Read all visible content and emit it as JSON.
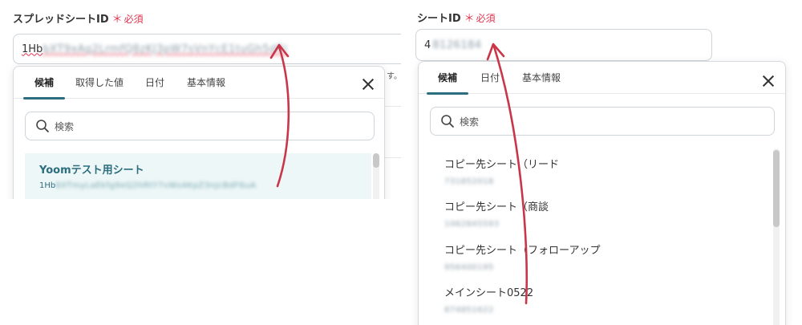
{
  "left": {
    "field": {
      "label": "スプレッドシートID",
      "required_star": "＊",
      "required_text": "必須",
      "value_visible": "1Hb",
      "value_blurred": "bXT9xAq2LrmfQ8zKJ3pW7sVnYcE1tuGh5dRi"
    },
    "hint_suffix": "す。",
    "tabs": [
      "候補",
      "取得した値",
      "日付",
      "基本情報"
    ],
    "active_tab": 0,
    "search_placeholder": "検索",
    "items": [
      {
        "label": "Yoomテスト用シート",
        "id_visible": "1Hb",
        "id_blurred": "8XTmyLaEkfg9eQ2hRtY7vWs4KpZ3nJcBdF6uA"
      }
    ]
  },
  "right": {
    "field": {
      "label": "シートID",
      "required_star": "＊",
      "required_text": "必須",
      "value_visible": "4",
      "value_blurred": "8126184"
    },
    "tabs": [
      "候補",
      "日付",
      "基本情報"
    ],
    "active_tab": 0,
    "search_placeholder": "検索",
    "items": [
      {
        "label": "コピー先シート（リード",
        "id_blurred": "731852018"
      },
      {
        "label": "コピー先シート（商談",
        "id_blurred": "1062845593"
      },
      {
        "label": "コピー先シート（フォローアップ",
        "id_blurred": "956400195"
      },
      {
        "label": "メインシート0522",
        "id_blurred": "874851622"
      }
    ]
  },
  "colors": {
    "accent": "#2c6e7f",
    "required": "#e0334e",
    "arrow": "#c9364a",
    "highlight_row": "#eef7f7"
  },
  "icons": [
    "search-icon",
    "close-icon"
  ]
}
